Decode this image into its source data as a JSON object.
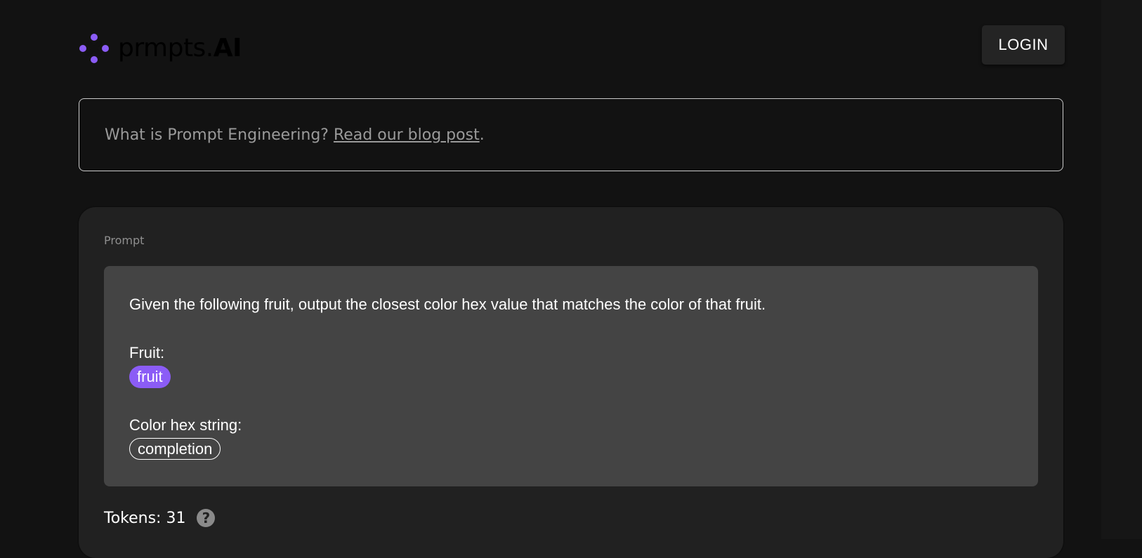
{
  "header": {
    "logo_text_light": "prmpts.",
    "logo_text_bold": "AI",
    "login_label": "LOGIN"
  },
  "banner": {
    "text": "What is Prompt Engineering?",
    "link_text": "Read our blog post",
    "suffix": "."
  },
  "prompt_card": {
    "label": "Prompt",
    "instruction": "Given the following fruit, output the closest color hex value that matches the color of that fruit.",
    "fruit_label": "Fruit:",
    "variable": "fruit",
    "hex_label": "Color hex string:",
    "completion": "completion",
    "tokens_text": "Tokens: 31",
    "help_icon": "?"
  },
  "colors": {
    "background": "#121212",
    "card": "#212121",
    "prompt_box": "#444444",
    "accent": "#8b5cf6",
    "logo_dots": "#8b5cf6"
  },
  "icons": [
    "logo-mark-icon",
    "help-icon"
  ]
}
